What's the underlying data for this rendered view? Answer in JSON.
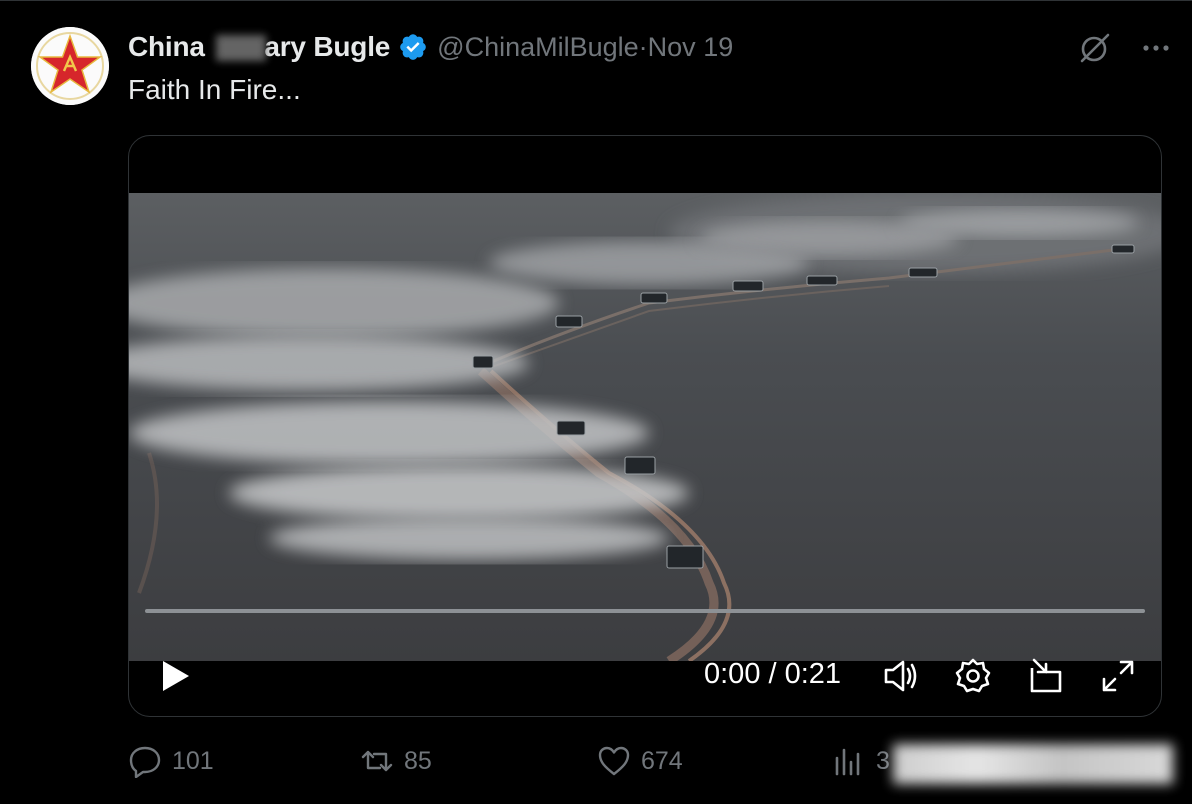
{
  "tweet": {
    "display_name_start": "China ",
    "display_name_end": "ary Bugle",
    "handle": "@ChinaMilBugle",
    "separator": " · ",
    "date": "Nov 19",
    "text": "Faith In Fire..."
  },
  "video": {
    "time": "0:00 / 0:21",
    "progress_fraction": 0
  },
  "actions": {
    "replies": "101",
    "reposts": "85",
    "likes": "674",
    "views": "3"
  },
  "colors": {
    "background": "#000000",
    "text": "#e7e9ea",
    "muted": "#71767b",
    "verified": "#1d9bf0",
    "avatar_star": "#d6262b"
  },
  "icons": [
    "grok-icon",
    "more-icon",
    "verified-badge-icon",
    "play-icon",
    "volume-icon",
    "settings-icon",
    "dock-icon",
    "fullscreen-icon",
    "reply-icon",
    "repost-icon",
    "like-icon",
    "views-icon"
  ]
}
